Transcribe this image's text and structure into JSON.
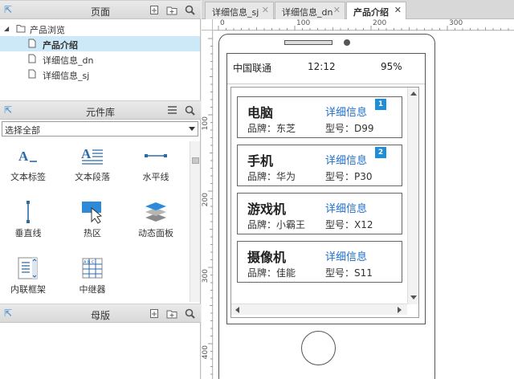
{
  "pages_panel": {
    "title": "页面",
    "tree": {
      "root": "产品浏览",
      "children": [
        "产品介绍",
        "详细信息_dn",
        "详细信息_sj"
      ],
      "selected_index": 0
    }
  },
  "library_panel": {
    "title": "元件库",
    "select": {
      "value": "选择全部"
    },
    "widgets": [
      {
        "label": "文本标签",
        "icon": "text-label-icon"
      },
      {
        "label": "文本段落",
        "icon": "text-paragraph-icon"
      },
      {
        "label": "水平线",
        "icon": "horizontal-line-icon"
      },
      {
        "label": "垂直线",
        "icon": "vertical-line-icon"
      },
      {
        "label": "热区",
        "icon": "hotspot-icon"
      },
      {
        "label": "动态面板",
        "icon": "dynamic-panel-icon"
      },
      {
        "label": "内联框架",
        "icon": "inline-frame-icon"
      },
      {
        "label": "中继器",
        "icon": "repeater-icon"
      }
    ]
  },
  "masters_panel": {
    "title": "母版"
  },
  "tabs": [
    {
      "label": "详细信息_sj",
      "active": false
    },
    {
      "label": "详细信息_dn",
      "active": false
    },
    {
      "label": "产品介绍",
      "active": true
    }
  ],
  "ruler": {
    "top_labels": [
      "0",
      "100",
      "200",
      "300"
    ],
    "left_labels": [
      "100",
      "200",
      "300",
      "400"
    ]
  },
  "phone": {
    "carrier": "中国联通",
    "time": "12:12",
    "battery": "95%",
    "items": [
      {
        "name": "电脑",
        "link": "详细信息",
        "brand": "品牌：东芝",
        "model": "型号：D99",
        "badge": "1"
      },
      {
        "name": "手机",
        "link": "详细信息",
        "brand": "品牌：华为",
        "model": "型号：P30",
        "badge": "2"
      },
      {
        "name": "游戏机",
        "link": "详细信息",
        "brand": "品牌：小霸王",
        "model": "型号：X12",
        "badge": ""
      },
      {
        "name": "摄像机",
        "link": "详细信息",
        "brand": "品牌：佳能",
        "model": "型号：S11",
        "badge": ""
      }
    ]
  },
  "colors": {
    "accent": "#1f6fd0",
    "badge": "#1f8ed8",
    "selected_row": "#cde8f6"
  }
}
